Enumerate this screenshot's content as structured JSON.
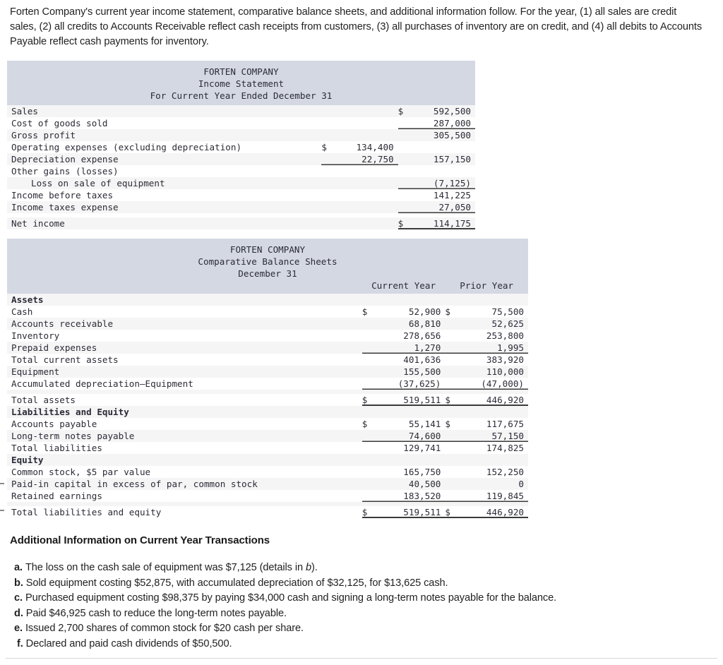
{
  "intro": "Forten Company's current year income statement, comparative balance sheets, and additional information follow. For the year, (1) all sales are credit sales, (2) all credits to Accounts Receivable reflect cash receipts from customers, (3) all purchases of inventory are on credit, and (4) all debits to Accounts Payable reflect cash payments for inventory.",
  "colors": {
    "header_band": "#d3d8e3",
    "zebra_row": "#f5f5f6",
    "rule": "#3a3a3a",
    "text": "#2b2b36"
  },
  "income_statement": {
    "title_line1": "FORTEN COMPANY",
    "title_line2": "Income Statement",
    "title_line3": "For Current Year Ended December 31",
    "currency_symbol": "$",
    "rows": [
      {
        "label": "Sales",
        "indent": 0,
        "bold": false,
        "cur_a": "",
        "amount_a": "",
        "cur_b": "$",
        "amount_b": "592,500",
        "rule_b": "none"
      },
      {
        "label": "Cost of goods sold",
        "indent": 0,
        "bold": false,
        "cur_a": "",
        "amount_a": "",
        "cur_b": "",
        "amount_b": "287,000",
        "rule_b": "single"
      },
      {
        "label": "Gross profit",
        "indent": 0,
        "bold": false,
        "cur_a": "",
        "amount_a": "",
        "cur_b": "",
        "amount_b": "305,500",
        "rule_b": "none"
      },
      {
        "label": "Operating expenses (excluding depreciation)",
        "indent": 0,
        "bold": false,
        "cur_a": "$",
        "amount_a": "134,400",
        "cur_b": "",
        "amount_b": "",
        "rule_b": "none"
      },
      {
        "label": "Depreciation expense",
        "indent": 0,
        "bold": false,
        "cur_a": "",
        "amount_a": "22,750",
        "cur_b": "",
        "amount_b": "157,150",
        "rule_b": "none",
        "rule_a": "single"
      },
      {
        "label": "Other gains (losses)",
        "indent": 0,
        "bold": false,
        "cur_a": "",
        "amount_a": "",
        "cur_b": "",
        "amount_b": "",
        "rule_b": "none"
      },
      {
        "label": "Loss on sale of equipment",
        "indent": 2,
        "bold": false,
        "cur_a": "",
        "amount_a": "",
        "cur_b": "",
        "amount_b": "(7,125)",
        "rule_b": "single"
      },
      {
        "label": "Income before taxes",
        "indent": 0,
        "bold": false,
        "cur_a": "",
        "amount_a": "",
        "cur_b": "",
        "amount_b": "141,225",
        "rule_b": "none"
      },
      {
        "label": "Income taxes expense",
        "indent": 0,
        "bold": false,
        "cur_a": "",
        "amount_a": "",
        "cur_b": "",
        "amount_b": "27,050",
        "rule_b": "single"
      },
      {
        "label": "Net income",
        "indent": 0,
        "bold": false,
        "cur_a": "",
        "amount_a": "",
        "cur_b": "$",
        "amount_b": "114,175",
        "rule_b": "double",
        "gap_before": true
      }
    ]
  },
  "balance_sheet": {
    "title_line1": "FORTEN COMPANY",
    "title_line2": "Comparative Balance Sheets",
    "title_line3": "December 31",
    "col_head_current": "Current Year",
    "col_head_prior": "Prior Year",
    "rows": [
      {
        "label": "Assets",
        "indent": 0,
        "bold": true,
        "cur_a": "",
        "amount_a": "",
        "cur_b": "",
        "amount_b": "",
        "rule": "none"
      },
      {
        "label": "Cash",
        "indent": 0,
        "bold": false,
        "cur_a": "$",
        "amount_a": "52,900",
        "cur_b": "$",
        "amount_b": "75,500",
        "rule": "none"
      },
      {
        "label": "Accounts receivable",
        "indent": 0,
        "bold": false,
        "cur_a": "",
        "amount_a": "68,810",
        "cur_b": "",
        "amount_b": "52,625",
        "rule": "none"
      },
      {
        "label": "Inventory",
        "indent": 0,
        "bold": false,
        "cur_a": "",
        "amount_a": "278,656",
        "cur_b": "",
        "amount_b": "253,800",
        "rule": "none"
      },
      {
        "label": "Prepaid expenses",
        "indent": 0,
        "bold": false,
        "cur_a": "",
        "amount_a": "1,270",
        "cur_b": "",
        "amount_b": "1,995",
        "rule": "single"
      },
      {
        "label": "Total current assets",
        "indent": 0,
        "bold": false,
        "cur_a": "",
        "amount_a": "401,636",
        "cur_b": "",
        "amount_b": "383,920",
        "rule": "none"
      },
      {
        "label": "Equipment",
        "indent": 0,
        "bold": false,
        "cur_a": "",
        "amount_a": "155,500",
        "cur_b": "",
        "amount_b": "110,000",
        "rule": "none"
      },
      {
        "label": "Accumulated depreciation–Equipment",
        "indent": 0,
        "bold": false,
        "cur_a": "",
        "amount_a": "(37,625)",
        "cur_b": "",
        "amount_b": "(47,000)",
        "rule": "single"
      },
      {
        "label": "Total assets",
        "indent": 0,
        "bold": false,
        "cur_a": "$",
        "amount_a": "519,511",
        "cur_b": "$",
        "amount_b": "446,920",
        "rule": "thick_below",
        "gap_before": true
      },
      {
        "label": "Liabilities and Equity",
        "indent": 0,
        "bold": true,
        "cur_a": "",
        "amount_a": "",
        "cur_b": "",
        "amount_b": "",
        "rule": "none"
      },
      {
        "label": "Accounts payable",
        "indent": 0,
        "bold": false,
        "cur_a": "$",
        "amount_a": "55,141",
        "cur_b": "$",
        "amount_b": "117,675",
        "rule": "none"
      },
      {
        "label": "Long-term notes payable",
        "indent": 0,
        "bold": false,
        "cur_a": "",
        "amount_a": "74,600",
        "cur_b": "",
        "amount_b": "57,150",
        "rule": "single"
      },
      {
        "label": "Total liabilities",
        "indent": 0,
        "bold": false,
        "cur_a": "",
        "amount_a": "129,741",
        "cur_b": "",
        "amount_b": "174,825",
        "rule": "none"
      },
      {
        "label": "Equity",
        "indent": 0,
        "bold": true,
        "cur_a": "",
        "amount_a": "",
        "cur_b": "",
        "amount_b": "",
        "rule": "none"
      },
      {
        "label": "Common stock, $5 par value",
        "indent": 0,
        "bold": false,
        "cur_a": "",
        "amount_a": "165,750",
        "cur_b": "",
        "amount_b": "152,250",
        "rule": "none"
      },
      {
        "label": "Paid-in capital in excess of par, common stock",
        "indent": 0,
        "bold": false,
        "cur_a": "",
        "amount_a": "40,500",
        "cur_b": "",
        "amount_b": "0",
        "rule": "none"
      },
      {
        "label": "Retained earnings",
        "indent": 0,
        "bold": false,
        "cur_a": "",
        "amount_a": "183,520",
        "cur_b": "",
        "amount_b": "119,845",
        "rule": "single"
      },
      {
        "label": "Total liabilities and equity",
        "indent": 0,
        "bold": false,
        "cur_a": "$",
        "amount_a": "519,511",
        "cur_b": "$",
        "amount_b": "446,920",
        "rule": "thick_below",
        "gap_before": true
      }
    ]
  },
  "additional_info": {
    "heading": "Additional Information on Current Year Transactions",
    "items": [
      {
        "marker": "a.",
        "text_before": "The loss on the cash sale of equipment was $7,125 (details in ",
        "italic": "b",
        "text_after": ")."
      },
      {
        "marker": "b.",
        "text_before": "Sold equipment costing $52,875, with accumulated depreciation of $32,125, for $13,625 cash.",
        "italic": "",
        "text_after": ""
      },
      {
        "marker": "c.",
        "text_before": "Purchased equipment costing $98,375 by paying $34,000 cash and signing a long-term notes payable for the balance.",
        "italic": "",
        "text_after": ""
      },
      {
        "marker": "d.",
        "text_before": "Paid $46,925 cash to reduce the long-term notes payable.",
        "italic": "",
        "text_after": ""
      },
      {
        "marker": "e.",
        "text_before": "Issued 2,700 shares of common stock for $20 cash per share.",
        "italic": "",
        "text_after": ""
      },
      {
        "marker": "f.",
        "text_before": "Declared and paid cash dividends of $50,500.",
        "italic": "",
        "text_after": ""
      }
    ]
  }
}
